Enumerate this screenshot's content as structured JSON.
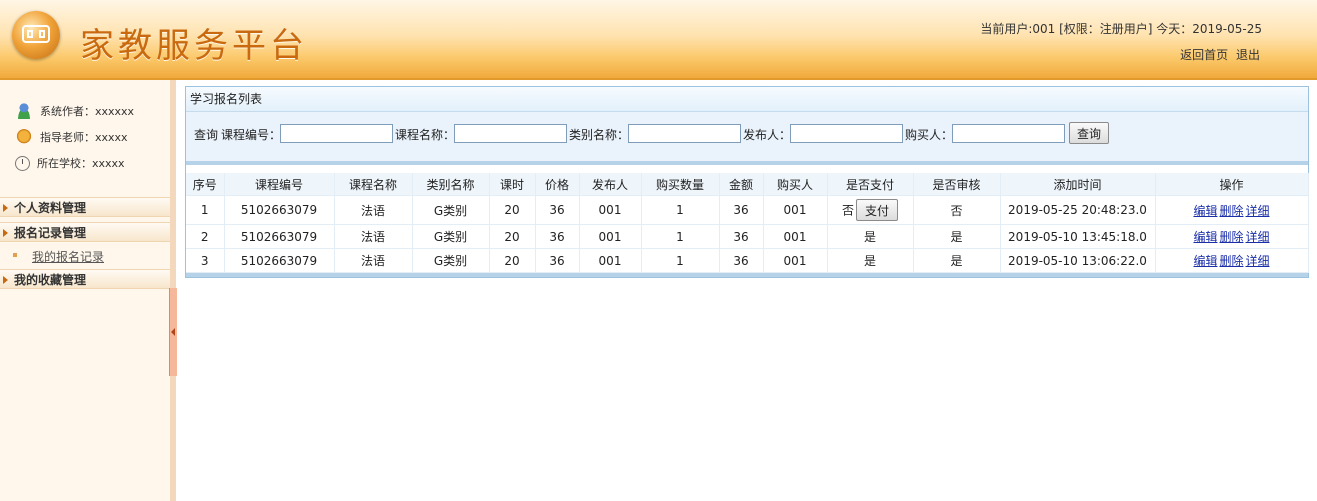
{
  "header": {
    "title": "家教服务平台",
    "user_info": "当前用户:001 [权限：注册用户] 今天：2019-05-25",
    "links": [
      "返回首页",
      "退出"
    ]
  },
  "sidebar": {
    "info": [
      {
        "icon": "user-icon",
        "label": "系统作者：xxxxxx"
      },
      {
        "icon": "teacher-icon",
        "label": "指导老师：xxxxx"
      },
      {
        "icon": "clock-icon",
        "label": "所在学校：xxxxx"
      }
    ],
    "menus": [
      {
        "label": "个人资料管理",
        "items": []
      },
      {
        "label": "报名记录管理",
        "items": [
          "我的报名记录"
        ]
      },
      {
        "label": "我的收藏管理",
        "items": []
      }
    ]
  },
  "panel": {
    "title": "学习报名列表",
    "search": {
      "query_label": "查询",
      "fields": [
        {
          "label": "课程编号：",
          "value": ""
        },
        {
          "label": "课程名称：",
          "value": ""
        },
        {
          "label": "类别名称：",
          "value": ""
        },
        {
          "label": "发布人：",
          "value": ""
        },
        {
          "label": "购买人：",
          "value": ""
        }
      ],
      "button": "查询"
    },
    "table": {
      "headers": [
        "序号",
        "课程编号",
        "课程名称",
        "类别名称",
        "课时",
        "价格",
        "发布人",
        "购买数量",
        "金额",
        "购买人",
        "是否支付",
        "是否审核",
        "添加时间",
        "操作"
      ],
      "rows": [
        [
          "1",
          "5102663079",
          "法语",
          "G类别",
          "20",
          "36",
          "001",
          "1",
          "36",
          "001",
          "否",
          "否",
          "2019-05-25 20:48:23.0"
        ],
        [
          "2",
          "5102663079",
          "法语",
          "G类别",
          "20",
          "36",
          "001",
          "1",
          "36",
          "001",
          "是",
          "是",
          "2019-05-10 13:45:18.0"
        ],
        [
          "3",
          "5102663079",
          "法语",
          "G类别",
          "20",
          "36",
          "001",
          "1",
          "36",
          "001",
          "是",
          "是",
          "2019-05-10 13:06:22.0"
        ]
      ],
      "pay_button": "支付",
      "actions": [
        "编辑",
        "删除",
        "详细"
      ]
    }
  }
}
